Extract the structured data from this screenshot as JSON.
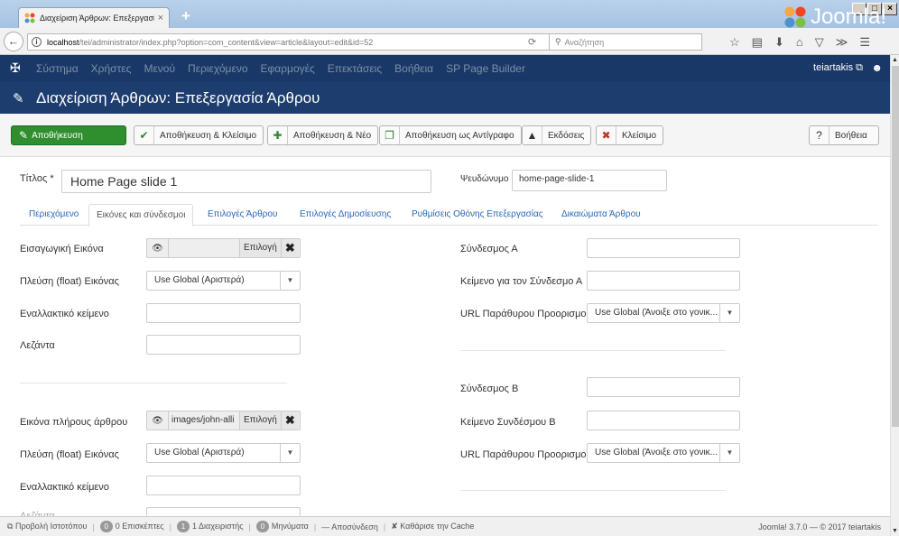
{
  "browser": {
    "tab_title": "Διαχείριση Άρθρων: Επεξεργασί",
    "tab_close": "×",
    "new_tab": "+",
    "url_host": "localhost",
    "url_path": "/tei/administrator/index.php?option=com_content&view=article&layout=edit&id=52",
    "search_placeholder": "Αναζήτηση",
    "window_buttons": [
      "_",
      "□",
      "×"
    ]
  },
  "admin_menu": {
    "items": [
      "Σύστημα",
      "Χρήστες",
      "Μενού",
      "Περιεχόμενο",
      "Εφαρμογές",
      "Επεκτάσεις",
      "Βοήθεια",
      "SP Page Builder"
    ],
    "user": "teiartakis"
  },
  "header": {
    "title": "Διαχείριση Άρθρων: Επεξεργασία Άρθρου",
    "brand": "Joomla!"
  },
  "toolbar": {
    "save": "Αποθήκευση",
    "save_close": "Αποθήκευση & Κλείσιμο",
    "save_new": "Αποθήκευση & Νέο",
    "save_copy": "Αποθήκευση ως Αντίγραφο",
    "versions": "Εκδόσεις",
    "close": "Κλείσιμο",
    "help": "Βοήθεια"
  },
  "form": {
    "title_label": "Τίτλος *",
    "title_value": "Home Page slide 1",
    "alias_label": "Ψευδώνυμο",
    "alias_value": "home-page-slide-1"
  },
  "tabs": [
    "Περιεχόμενο",
    "Εικόνες και σύνδεσμοι",
    "Επιλογές Άρθρου",
    "Επιλογές Δημοσίευσης",
    "Ρυθμίσεις Οθόνης Επεξεργασίας",
    "Δικαιώματα Άρθρου"
  ],
  "images": {
    "intro_image_label": "Εισαγωγική Εικόνα",
    "intro_image_path": "",
    "select_label": "Επιλογή",
    "float_label": "Πλεύση (float) Εικόνας",
    "float_value": "Use Global (Αριστερά)",
    "alt_label": "Εναλλακτικό κείμενο",
    "caption_label": "Λεζάντα",
    "full_image_label": "Εικόνα πλήρους άρθρου",
    "full_image_path": "images/john-alli",
    "full_float_label": "Πλεύση (float) Εικόνας",
    "full_float_value": "Use Global (Αριστερά)",
    "full_alt_label": "Εναλλακτικό κείμενο",
    "full_caption_label": "Λεζάντα"
  },
  "links": {
    "link_a_label": "Σύνδεσμος Α",
    "link_a_text_label": "Κείμενο για τον Σύνδεσμο Α",
    "link_a_window_label": "URL Παράθυρου Προορισμού",
    "link_a_window_value": "Use Global (Άνοιξε στο γονικ...",
    "link_b_label": "Σύνδεσμος Β",
    "link_b_text_label": "Κείμενο Συνδέσμου Β",
    "link_b_window_label": "URL Παράθυρου Προορισμού",
    "link_b_window_value": "Use Global (Άνοιξε στο γονικ..."
  },
  "status": {
    "view_site": "Προβολή Ιστοτόπου",
    "visitors_count": "0",
    "visitors": "0 Επισκέπτες",
    "admins_count": "1",
    "admins": "1 Διαχειριστής",
    "messages_count": "0",
    "messages": "Μηνύματα",
    "logout": "Αποσύνδεση",
    "clear_cache": "Καθάρισε την Cache",
    "copyright": "Joomla! 3.7.0 — © 2017 teiartakis"
  },
  "colors": {
    "admin_menu_bg": "#1a3867",
    "header_bg": "#1c3d6e",
    "save_green": "#2f8f2f",
    "link_blue": "#2a69b8"
  }
}
